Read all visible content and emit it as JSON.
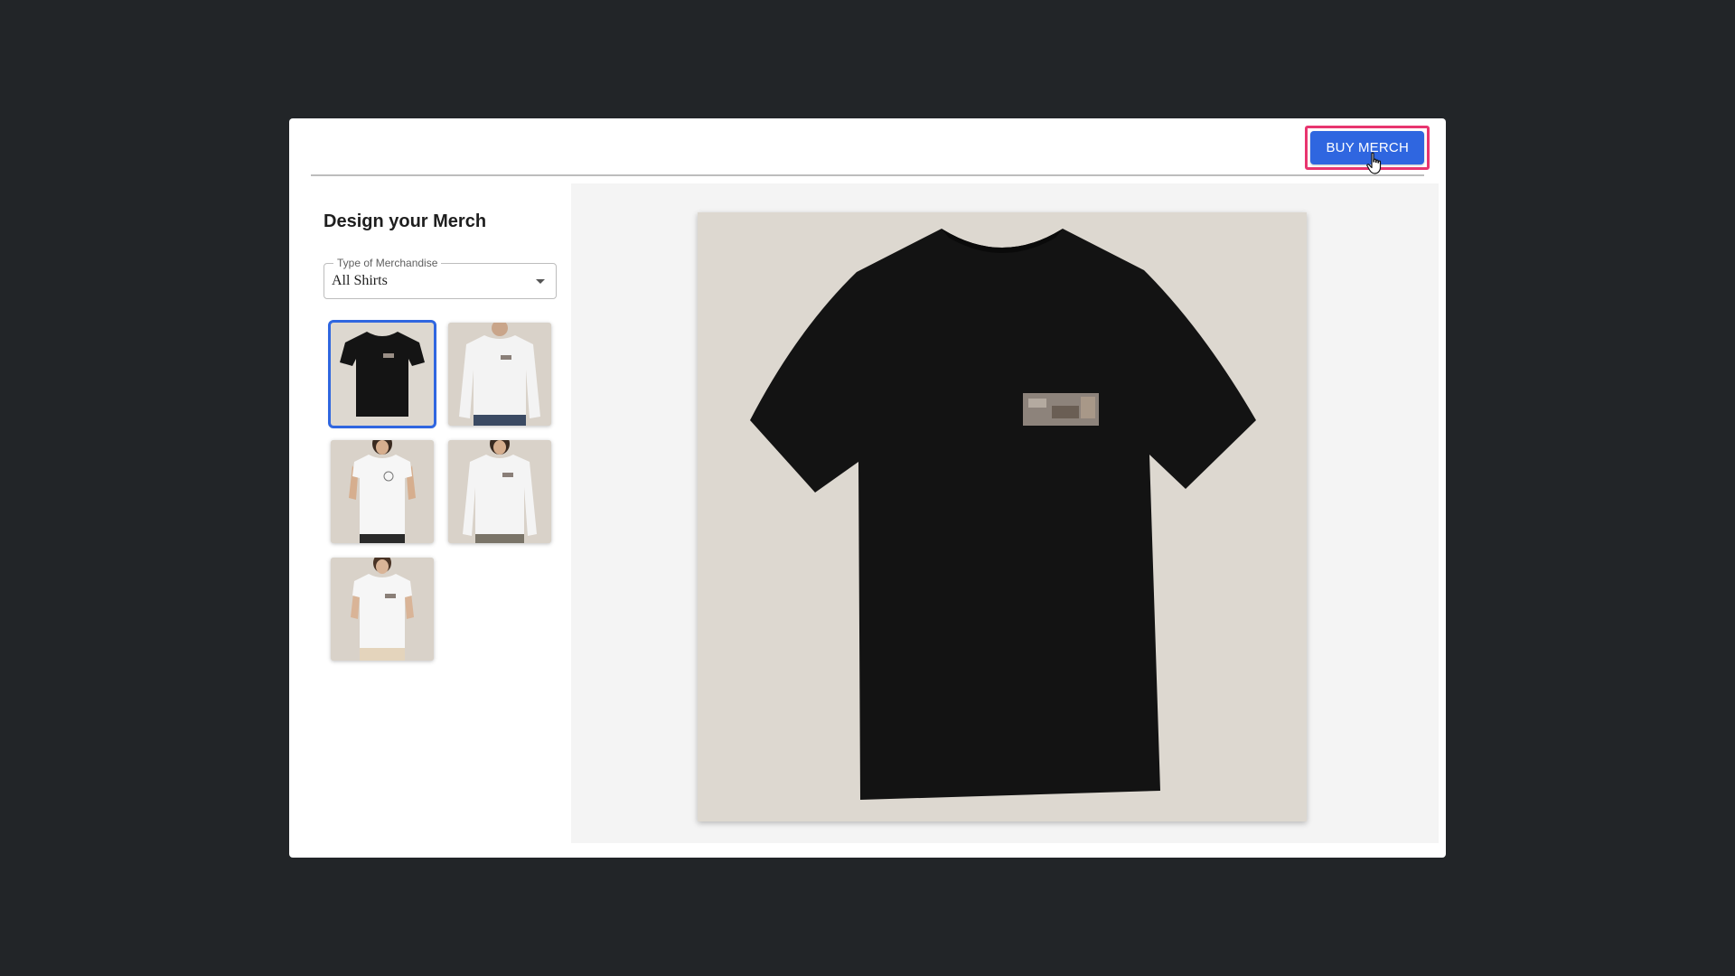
{
  "header": {
    "buy_button_label": "BUY MERCH"
  },
  "panel": {
    "title": "Design your Merch",
    "select_label": "Type of Merchandise",
    "select_value": "All Shirts"
  },
  "products": [
    {
      "name": "black-tshirt",
      "selected": true
    },
    {
      "name": "white-longsleeve-men",
      "selected": false
    },
    {
      "name": "white-tshirt-women-round-logo",
      "selected": false
    },
    {
      "name": "white-longsleeve-women",
      "selected": false
    },
    {
      "name": "white-tshirt-kids",
      "selected": false
    }
  ],
  "colors": {
    "accent": "#2f66e0",
    "highlight": "#e8356f",
    "backdrop": "#222528",
    "shirt_black": "#141414",
    "shirt_white": "#f5f5f5",
    "photo_bg": "#ddd8d0"
  }
}
